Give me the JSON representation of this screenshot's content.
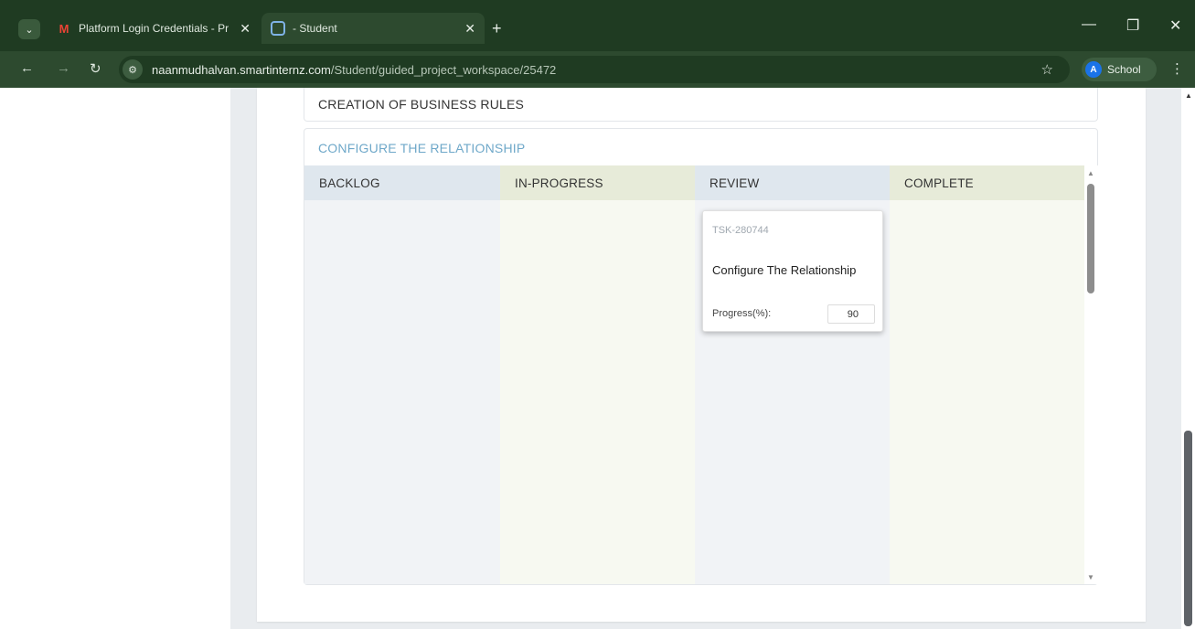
{
  "browser": {
    "tabs": [
      {
        "title": "Platform Login Credentials - Pr",
        "icon": "gmail-icon",
        "active": false
      },
      {
        "title": "- Student",
        "icon": "student-icon",
        "active": true
      }
    ],
    "new_tab_glyph": "+",
    "address": {
      "host": "naanmudhalvan.smartinternz.com",
      "path": "/Student/guided_project_workspace/25472"
    },
    "profile": {
      "initial": "A",
      "name": "School"
    }
  },
  "page": {
    "sections": {
      "rules_title": "CREATION OF BUSINESS RULES",
      "config_title": "CONFIGURE THE RELATIONSHIP"
    },
    "board": {
      "columns": [
        "BACKLOG",
        "IN-PROGRESS",
        "REVIEW",
        "COMPLETE"
      ],
      "card": {
        "id": "TSK-280744",
        "title": "Configure The Relationship",
        "progress_label": "Progress(%):",
        "progress_value": "90",
        "column": "REVIEW"
      }
    }
  },
  "colors": {
    "tabbar": "#1f3b22",
    "toolbar": "#2d4a2f",
    "accent_title": "#6fa8c9",
    "col_blue_head": "#dfe7ee",
    "col_green_head": "#e7ebd9"
  }
}
